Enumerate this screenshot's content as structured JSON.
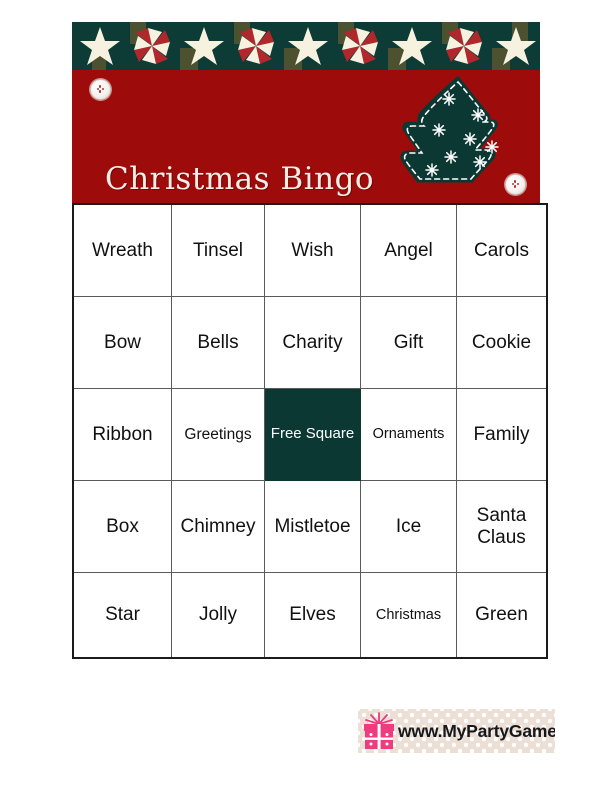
{
  "card": {
    "title": "Christmas Bingo",
    "header_color": "#9e0b0b",
    "border_color": "#0d3b35",
    "free_square_color": "#0b3833",
    "tree_color": "#0b3833",
    "grid": {
      "rows": [
        [
          {
            "label": "Wreath",
            "size": "normal",
            "free": false
          },
          {
            "label": "Tinsel",
            "size": "normal",
            "free": false
          },
          {
            "label": "Wish",
            "size": "normal",
            "free": false
          },
          {
            "label": "Angel",
            "size": "normal",
            "free": false
          },
          {
            "label": "Carols",
            "size": "normal",
            "free": false
          }
        ],
        [
          {
            "label": "Bow",
            "size": "normal",
            "free": false
          },
          {
            "label": "Bells",
            "size": "normal",
            "free": false
          },
          {
            "label": "Charity",
            "size": "normal",
            "free": false
          },
          {
            "label": "Gift",
            "size": "normal",
            "free": false
          },
          {
            "label": "Cookie",
            "size": "normal",
            "free": false
          }
        ],
        [
          {
            "label": "Ribbon",
            "size": "normal",
            "free": false
          },
          {
            "label": "Greetings",
            "size": "small",
            "free": false
          },
          {
            "label": "Free Square",
            "size": "small",
            "free": true
          },
          {
            "label": "Ornaments",
            "size": "xsmall",
            "free": false
          },
          {
            "label": "Family",
            "size": "normal",
            "free": false
          }
        ],
        [
          {
            "label": "Box",
            "size": "normal",
            "free": false
          },
          {
            "label": "Chimney",
            "size": "normal",
            "free": false
          },
          {
            "label": "Mistletoe",
            "size": "normal",
            "free": false
          },
          {
            "label": "Ice",
            "size": "normal",
            "free": false
          },
          {
            "label": "Santa Claus",
            "size": "normal",
            "free": false
          }
        ],
        [
          {
            "label": "Star",
            "size": "normal",
            "free": false
          },
          {
            "label": "Jolly",
            "size": "normal",
            "free": false
          },
          {
            "label": "Elves",
            "size": "normal",
            "free": false
          },
          {
            "label": "Christmas",
            "size": "xsmall",
            "free": false
          },
          {
            "label": "Green",
            "size": "normal",
            "free": false
          }
        ]
      ]
    }
  },
  "footer": {
    "url": "www.MyPartyGames.com",
    "icon": "gift-box-icon",
    "background_color": "#ece0d6",
    "gift_color": "#ee3d7f"
  }
}
